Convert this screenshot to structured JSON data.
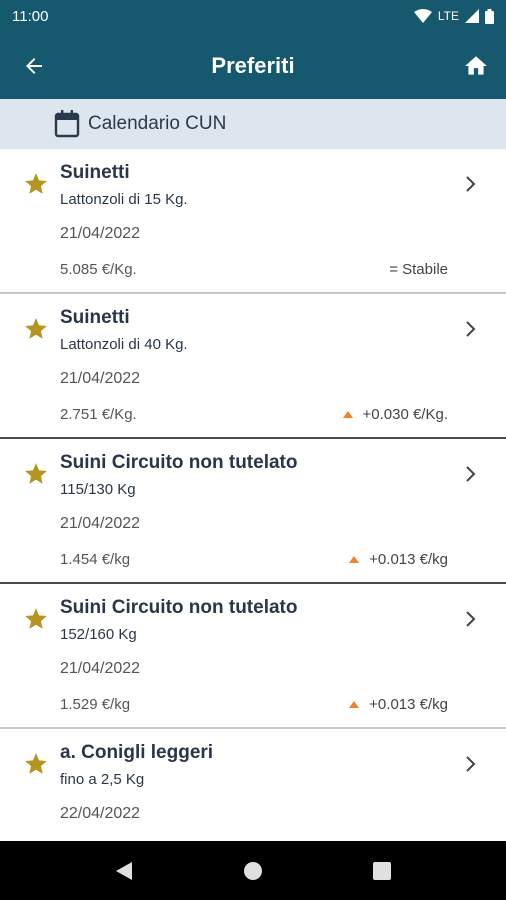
{
  "status": {
    "time": "11:00",
    "network": "LTE"
  },
  "header": {
    "title": "Preferiti"
  },
  "calendar": {
    "label": "Calendario CUN"
  },
  "items": [
    {
      "title": "Suinetti",
      "subtitle": "Lattonzoli di 15 Kg.",
      "date": "21/04/2022",
      "price": "5.085 €/Kg.",
      "change": "= Stabile",
      "trend": "stable"
    },
    {
      "title": "Suinetti",
      "subtitle": "Lattonzoli di 40 Kg.",
      "date": "21/04/2022",
      "price": "2.751 €/Kg.",
      "change": "+0.030 €/Kg.",
      "trend": "up"
    },
    {
      "title": "Suini Circuito non tutelato",
      "subtitle": "115/130 Kg",
      "date": "21/04/2022",
      "price": "1.454 €/kg",
      "change": "+0.013 €/kg",
      "trend": "up"
    },
    {
      "title": "Suini Circuito non tutelato",
      "subtitle": "152/160 Kg",
      "date": "21/04/2022",
      "price": "1.529 €/kg",
      "change": "+0.013 €/kg",
      "trend": "up"
    },
    {
      "title": "a. Conigli leggeri",
      "subtitle": "fino a 2,5 Kg",
      "date": "22/04/2022",
      "price": "",
      "change": "",
      "trend": ""
    }
  ],
  "colors": {
    "primary": "#16596e",
    "calendar_bg": "#dde6ee",
    "star": "#b5941f",
    "trend_up": "#f0822a"
  }
}
